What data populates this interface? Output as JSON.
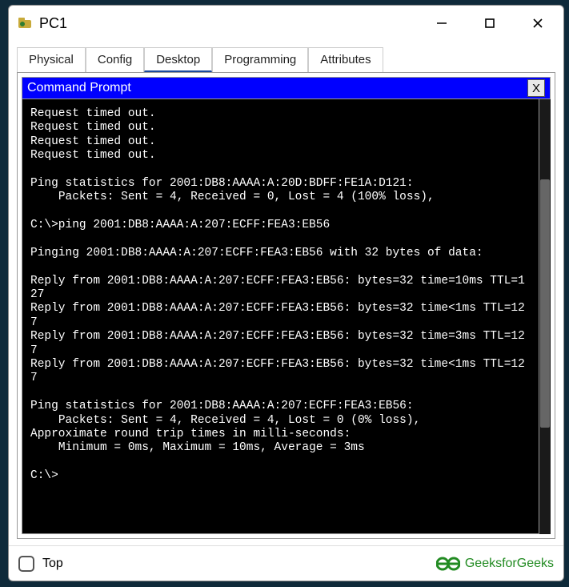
{
  "window": {
    "title": "PC1",
    "min_label": "Minimize",
    "max_label": "Maximize",
    "close_label": "Close"
  },
  "tabs": [
    {
      "label": "Physical",
      "active": false
    },
    {
      "label": "Config",
      "active": false
    },
    {
      "label": "Desktop",
      "active": true
    },
    {
      "label": "Programming",
      "active": false
    },
    {
      "label": "Attributes",
      "active": false
    }
  ],
  "command_prompt": {
    "title": "Command Prompt",
    "close_label": "X",
    "lines": [
      "Request timed out.",
      "Request timed out.",
      "Request timed out.",
      "Request timed out.",
      "",
      "Ping statistics for 2001:DB8:AAAA:A:20D:BDFF:FE1A:D121:",
      "    Packets: Sent = 4, Received = 0, Lost = 4 (100% loss),",
      "",
      "C:\\>ping 2001:DB8:AAAA:A:207:ECFF:FEA3:EB56",
      "",
      "Pinging 2001:DB8:AAAA:A:207:ECFF:FEA3:EB56 with 32 bytes of data:",
      "",
      "Reply from 2001:DB8:AAAA:A:207:ECFF:FEA3:EB56: bytes=32 time=10ms TTL=127",
      "Reply from 2001:DB8:AAAA:A:207:ECFF:FEA3:EB56: bytes=32 time<1ms TTL=127",
      "Reply from 2001:DB8:AAAA:A:207:ECFF:FEA3:EB56: bytes=32 time=3ms TTL=127",
      "Reply from 2001:DB8:AAAA:A:207:ECFF:FEA3:EB56: bytes=32 time<1ms TTL=127",
      "",
      "Ping statistics for 2001:DB8:AAAA:A:207:ECFF:FEA3:EB56:",
      "    Packets: Sent = 4, Received = 4, Lost = 0 (0% loss),",
      "Approximate round trip times in milli-seconds:",
      "    Minimum = 0ms, Maximum = 10ms, Average = 3ms",
      "",
      "C:\\>"
    ]
  },
  "bottom": {
    "checkbox_label": "Top",
    "checkbox_checked": false
  },
  "watermark": {
    "text": "GeeksforGeeks"
  }
}
